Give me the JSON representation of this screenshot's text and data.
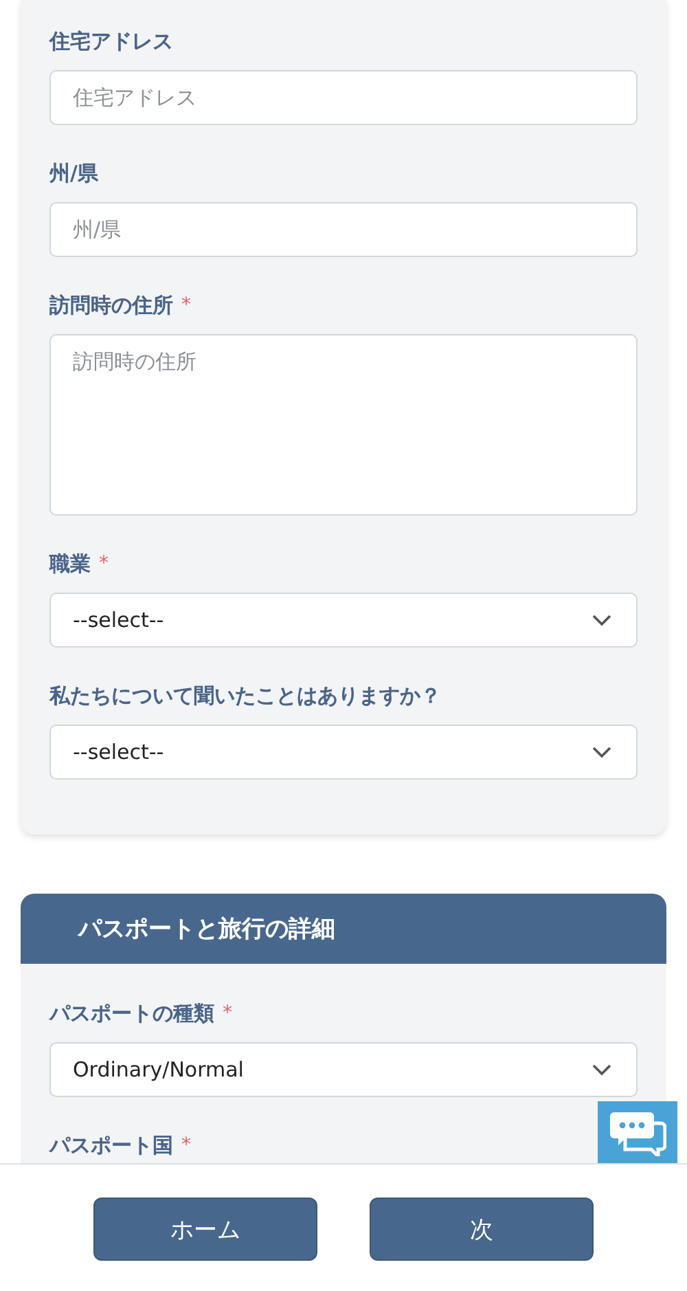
{
  "sections": [
    {
      "fields": [
        {
          "kind": "input",
          "label": "住宅アドレス",
          "placeholder": "住宅アドレス"
        },
        {
          "kind": "input",
          "label": "州/県",
          "placeholder": "州/県"
        },
        {
          "kind": "textarea",
          "label": "訪問時の住所",
          "mark": "*",
          "placeholder": "訪問時の住所"
        },
        {
          "kind": "select",
          "label": "職業",
          "mark": "*",
          "value": "--select--"
        },
        {
          "kind": "select",
          "label": "私たちについて聞いたことはありますか？",
          "value": "--select--"
        }
      ]
    },
    {
      "title": "パスポートと旅行の詳細",
      "fields": [
        {
          "kind": "select",
          "label": "パスポートの種類",
          "mark": "*",
          "value": "Ordinary/Normal"
        },
        {
          "kind": "label",
          "label": "パスポート国",
          "mark": "*"
        }
      ]
    }
  ],
  "footer": {
    "buttons": [
      "ホーム",
      "次"
    ]
  }
}
